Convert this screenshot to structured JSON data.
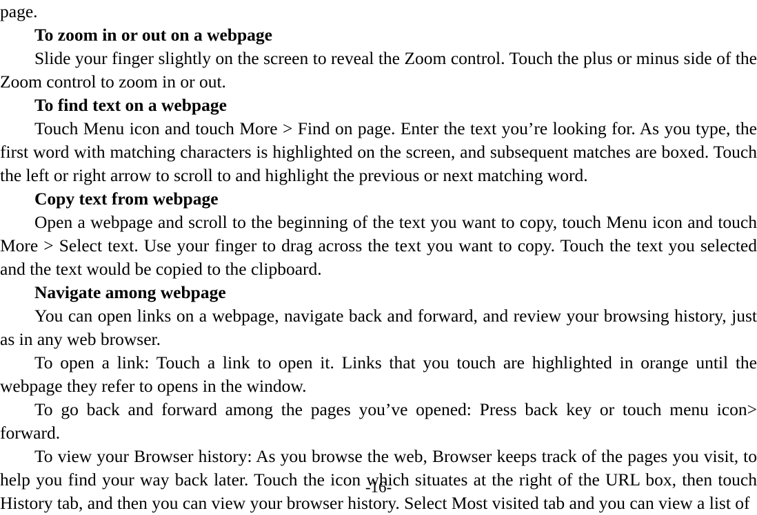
{
  "document": {
    "page_number_label": "-16-",
    "blocks": [
      {
        "type": "paragraph_continuation",
        "name": "paragraph-page-continuation",
        "text": "page."
      },
      {
        "type": "heading",
        "name": "heading-zoom-in-or-out",
        "text": "To zoom in or out on a webpage"
      },
      {
        "type": "paragraph",
        "name": "paragraph-zoom-in-or-out",
        "text": "Slide your finger slightly on the screen to reveal the Zoom control. Touch the plus or minus side of the Zoom control to zoom in or out."
      },
      {
        "type": "heading",
        "name": "heading-find-text",
        "text": "To find text on a webpage"
      },
      {
        "type": "paragraph",
        "name": "paragraph-find-text",
        "text": "Touch Menu icon and touch More > Find on page. Enter the text you’re looking for. As you type, the first word with matching characters is highlighted on the screen, and subsequent matches are boxed. Touch the left or right arrow to scroll to and highlight the previous or next matching word."
      },
      {
        "type": "heading",
        "name": "heading-copy-text",
        "text": "Copy text from webpage"
      },
      {
        "type": "paragraph",
        "name": "paragraph-copy-text",
        "text": "Open a webpage and scroll to the beginning of the text you want to copy, touch Menu icon and touch More > Select text. Use your finger to drag across the text you want to copy. Touch the text you selected and the text would be copied to the clipboard."
      },
      {
        "type": "heading",
        "name": "heading-navigate-among-webpage",
        "text": "Navigate among webpage"
      },
      {
        "type": "paragraph",
        "name": "paragraph-navigate-intro",
        "text": "You can open links on a webpage, navigate back and forward, and review your browsing history, just as in any web browser."
      },
      {
        "type": "paragraph",
        "name": "paragraph-open-link",
        "text": "To open a link: Touch a link to open it. Links that you touch are highlighted in orange until the webpage they refer to opens in the window."
      },
      {
        "type": "paragraph",
        "name": "paragraph-go-back-forward",
        "text": "To go back and forward among the pages you’ve opened: Press back key or touch menu icon> forward."
      },
      {
        "type": "paragraph",
        "name": "paragraph-browser-history",
        "text": "To view your Browser history: As you browse the web, Browser keeps track of the pages you visit, to help you find your way back later. Touch the icon which situates at the right of the URL box, then touch History tab, and then you can view your browser history. Select Most visited tab and you can view a list of"
      }
    ]
  }
}
